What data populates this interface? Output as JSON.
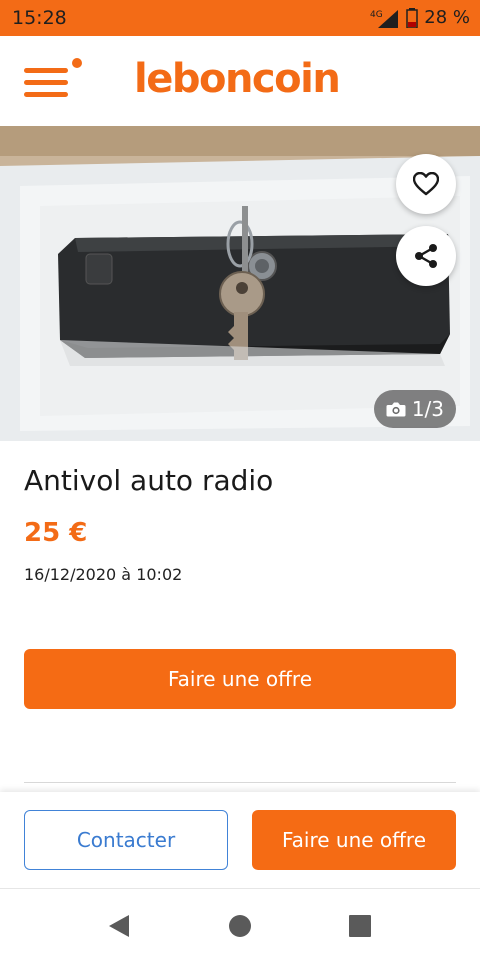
{
  "status_bar": {
    "time": "15:28",
    "network": "4G",
    "battery": "28 %"
  },
  "header": {
    "logo_text": "leboncoin",
    "menu_icon": "hamburger-menu-icon",
    "notification_dot": true
  },
  "gallery": {
    "photo_counter": "1/3",
    "current_photo": 1,
    "total_photos": 3,
    "favorite_icon": "heart-icon",
    "share_icon": "share-icon",
    "camera_icon": "camera-icon"
  },
  "listing": {
    "title": "Antivol auto radio",
    "price": "25 €",
    "date": "16/12/2020 à 10:02"
  },
  "actions": {
    "offer_main_label": "Faire une offre",
    "contact_label": "Contacter",
    "offer_label": "Faire une offre"
  },
  "nav": {
    "back_icon": "back-triangle-icon",
    "home_icon": "home-circle-icon",
    "recent_icon": "recents-square-icon"
  },
  "colors": {
    "brand_orange": "#f36b16",
    "contact_blue": "#3a7bd0"
  }
}
